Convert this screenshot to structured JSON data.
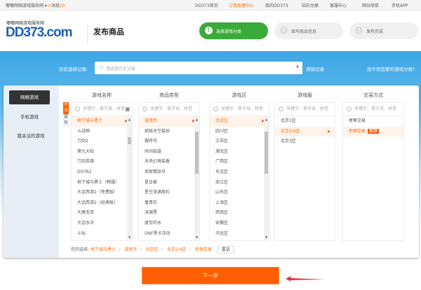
{
  "topbar": {
    "site_menu": "嘟嘟网络游戏服务网",
    "messages_label": "消息",
    "messages_count": "20",
    "links": [
      "DD373首页",
      "订单处理中心",
      "我的DD373",
      "钻石兑换",
      "客服中心",
      "网站导航",
      "手机APP"
    ]
  },
  "header": {
    "logo_tagline": "嘟嘟网络游戏服务网",
    "logo_text": "DD373.com",
    "page_title": "发布商品",
    "steps": [
      {
        "num": "1",
        "label": "选择游戏分类",
        "active": true
      },
      {
        "num": "2",
        "label": "填写商品信息",
        "active": false
      },
      {
        "num": "3",
        "label": "发布完成",
        "active": false
      }
    ]
  },
  "history": {
    "label": "历史选择记录:",
    "placeholder": "请选择历史记录",
    "clear": "清除记录",
    "not_found": "找不到您要的游戏分类?"
  },
  "sidebar": {
    "items": [
      {
        "label": "网络游戏",
        "active": true
      },
      {
        "label": "手机游戏"
      },
      {
        "label": "我关注的游戏"
      }
    ]
  },
  "columns": [
    {
      "title": "游戏名称",
      "search": "关键字、首字母、拼音",
      "items": [
        "地下城与勇士",
        "斗战神",
        "刀剑2",
        "第九大陆",
        "刀剑英雄",
        "DOTA2",
        "地下城与勇士（韩服）",
        "大话西游2（免费版）",
        "大话西游2（经典版）",
        "大唐无双",
        "大话水浒",
        "斗仙"
      ],
      "selected": 0
    },
    {
      "title": "商品类型",
      "search": "关键字、首字母、拼音",
      "items": [
        "游戏币",
        "绝版天空装扮",
        "搬砖号",
        "时间结晶",
        "未央幻境装备",
        "商家精品号",
        "夏日套",
        "星空深渊原石",
        "堇青石",
        "深渊票",
        "疲劳药水",
        "DNF黑卡活动"
      ],
      "selected": 0
    },
    {
      "title": "游戏区",
      "search": "关键字、首字母、拼音",
      "items": [
        "北京区",
        "四川区",
        "江苏区",
        "湖北区",
        "广西区",
        "东北区",
        "浙江区",
        "山东区",
        "上海区",
        "西南区",
        "安徽区",
        "河北区"
      ],
      "selected": 0
    },
    {
      "title": "游戏服",
      "search": "关键字、首字母、拼音",
      "items": [
        "北京1区",
        "北京2/4区",
        "北京3区"
      ],
      "selected": 1
    },
    {
      "title": "交易方式",
      "search": "关键字、首字母、拼音",
      "items": [
        "寄售交易",
        "担保交易"
      ],
      "selected": 1,
      "badge": "推荐"
    }
  ],
  "letter_tabs": [
    "字母",
    "图标"
  ],
  "selection": {
    "label": "您的选择:",
    "path": [
      "地下城与勇士",
      "游戏币",
      "北京区",
      "北京2/4区",
      "担保交易"
    ],
    "reset": "重选"
  },
  "next_button": "下一步",
  "colors": {
    "accent": "#ff6000",
    "green": "#3aaa3a",
    "blue": "#3ea6e6"
  }
}
